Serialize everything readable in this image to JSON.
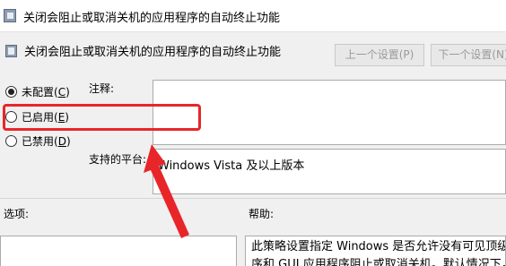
{
  "window": {
    "title": "关闭会阻止或取消关机的应用程序的自动终止功能"
  },
  "header": {
    "policy_title": "关闭会阻止或取消关机的应用程序的自动终止功能",
    "prev_button": "上一个设置(P)",
    "next_button": "下一个设置(N)"
  },
  "options": {
    "not_configured": "未配置(C)",
    "enabled": "已启用(E)",
    "disabled": "已禁用(D)",
    "selected": "not_configured"
  },
  "comment": {
    "label": "注释:",
    "value": ""
  },
  "platform": {
    "label": "支持的平台:",
    "value": "Windows Vista 及以上版本"
  },
  "sections": {
    "options_label": "选项:",
    "help_label": "帮助:"
  },
  "help": {
    "line1": "此策略设置指定 Windows 是否允许没有可见顶级窗口",
    "line2": "序和 GUI 应用程序阻止或取消关机。默认情况下，如果"
  },
  "annotation": {
    "highlight_color": "#e8262a"
  },
  "colors": {
    "background": "#f0f0f0",
    "disabled_text": "#9a9a9a"
  }
}
